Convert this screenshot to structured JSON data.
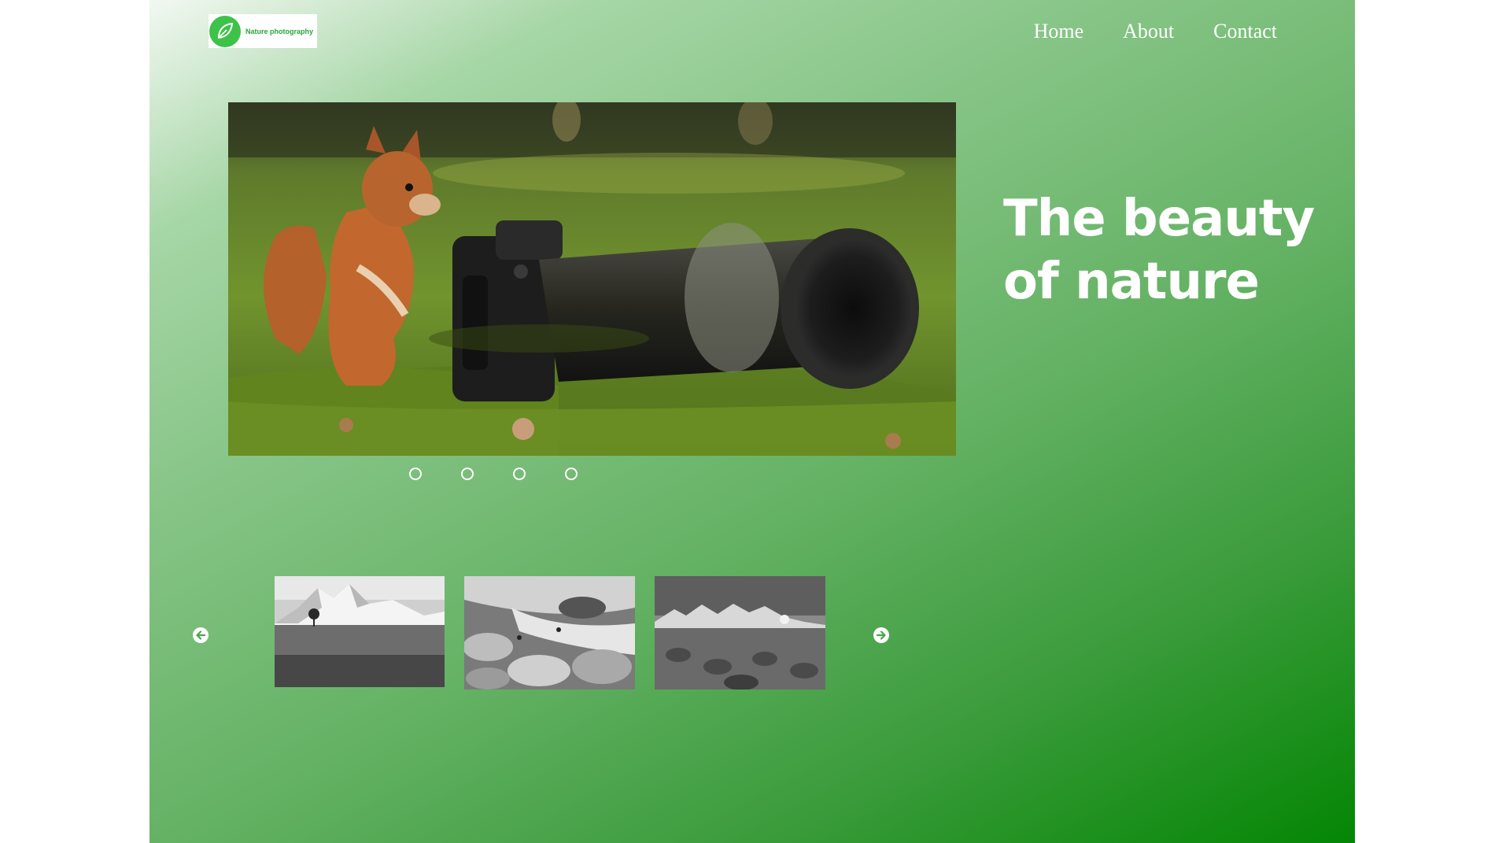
{
  "logo": {
    "text": "Nature photography",
    "icon": "leaf-icon",
    "color": "#3ec24a"
  },
  "nav": {
    "items": [
      "Home",
      "About",
      "Contact"
    ]
  },
  "hero": {
    "title": "The beauty of nature",
    "image": "squirrel-with-camera",
    "slide_count": 4
  },
  "gallery": {
    "prev_icon": "arrow-left-circle-icon",
    "next_icon": "arrow-right-circle-icon",
    "thumbnails": [
      "snowy-mountains-meadow",
      "rocky-river-stream",
      "mountain-range-field"
    ]
  },
  "colors": {
    "gradient_start": "#f2f8f2",
    "gradient_end": "#048604",
    "text": "#ffffff"
  }
}
